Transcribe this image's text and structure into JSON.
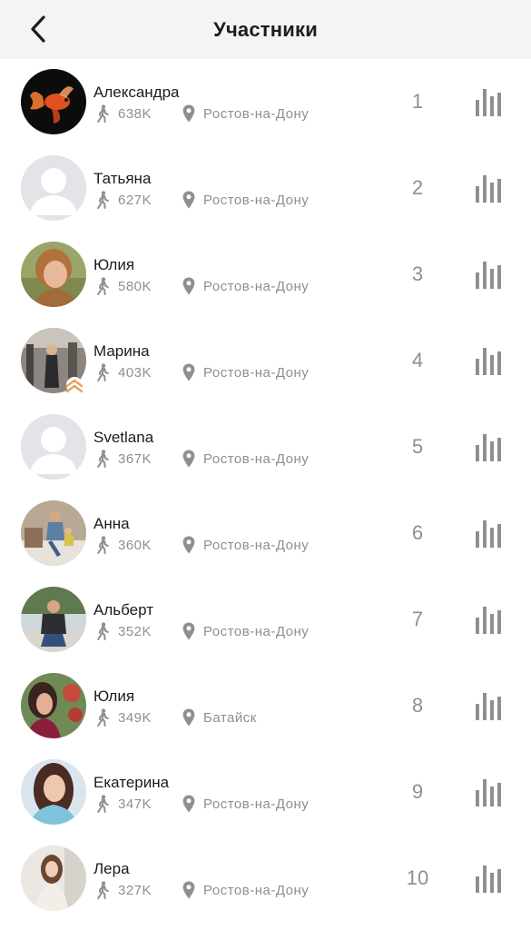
{
  "header": {
    "title": "Участники"
  },
  "participants": [
    {
      "rank": "1",
      "name": "Александра",
      "steps": "638K",
      "city": "Ростов-на-Дону",
      "avatar": "photo-fish"
    },
    {
      "rank": "2",
      "name": "Татьяна",
      "steps": "627K",
      "city": "Ростов-на-Дону",
      "avatar": "placeholder"
    },
    {
      "rank": "3",
      "name": "Юлия",
      "steps": "580K",
      "city": "Ростов-на-Дону",
      "avatar": "photo"
    },
    {
      "rank": "4",
      "name": "Марина",
      "steps": "403K",
      "city": "Ростов-на-Дону",
      "avatar": "photo",
      "badge": "double-chevron-up-icon"
    },
    {
      "rank": "5",
      "name": "Svetlana",
      "steps": "367K",
      "city": "Ростов-на-Дону",
      "avatar": "placeholder"
    },
    {
      "rank": "6",
      "name": "Анна",
      "steps": "360K",
      "city": "Ростов-на-Дону",
      "avatar": "photo"
    },
    {
      "rank": "7",
      "name": "Альберт",
      "steps": "352K",
      "city": "Ростов-на-Дону",
      "avatar": "photo"
    },
    {
      "rank": "8",
      "name": "Юлия",
      "steps": "349K",
      "city": "Батайск",
      "avatar": "photo"
    },
    {
      "rank": "9",
      "name": "Екатерина",
      "steps": "347K",
      "city": "Ростов-на-Дону",
      "avatar": "photo"
    },
    {
      "rank": "10",
      "name": "Лера",
      "steps": "327K",
      "city": "Ростов-на-Дону",
      "avatar": "photo"
    }
  ],
  "icons": {
    "back": "chevron-left-icon",
    "steps": "walk-icon",
    "location": "pin-icon",
    "stats": "bar-chart-icon"
  },
  "colors": {
    "header_bg": "#f4f4f5",
    "text": "#1c1c1e",
    "secondary": "#8e8e93",
    "boost": "#e6a35c"
  }
}
